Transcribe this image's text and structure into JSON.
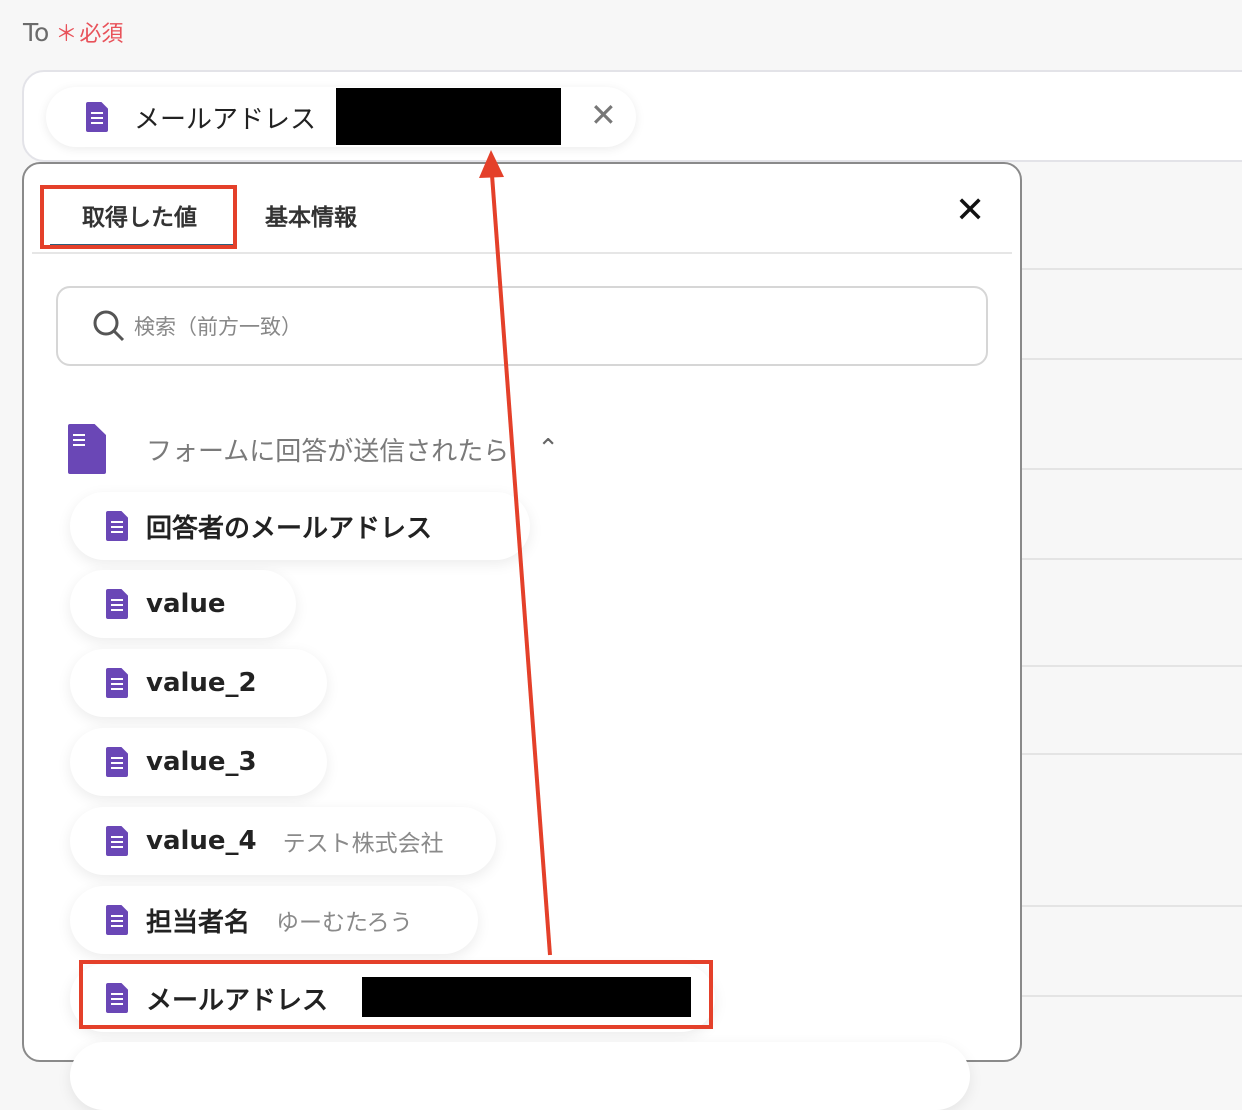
{
  "field": {
    "label": "To",
    "required_mark": "＊",
    "required_text": "必須",
    "chip_label": "メールアドレス"
  },
  "panel": {
    "tabs": [
      {
        "label": "取得した値",
        "active": true
      },
      {
        "label": "基本情報",
        "active": false
      }
    ],
    "search_placeholder": "検索（前方一致）",
    "group_title": "フォームに回答が送信されたら",
    "items": [
      {
        "label": "回答者のメールアドレス",
        "value": ""
      },
      {
        "label": "value",
        "value": ""
      },
      {
        "label": "value_2",
        "value": ""
      },
      {
        "label": "value_3",
        "value": ""
      },
      {
        "label": "value_4",
        "value": "テスト株式会社"
      },
      {
        "label": "担当者名",
        "value": "ゆーむたろう"
      },
      {
        "label": "メールアドレス",
        "value": ""
      }
    ]
  },
  "colors": {
    "accent": "#6a47b6",
    "annotation": "#e4402a",
    "required": "#e8525a"
  }
}
